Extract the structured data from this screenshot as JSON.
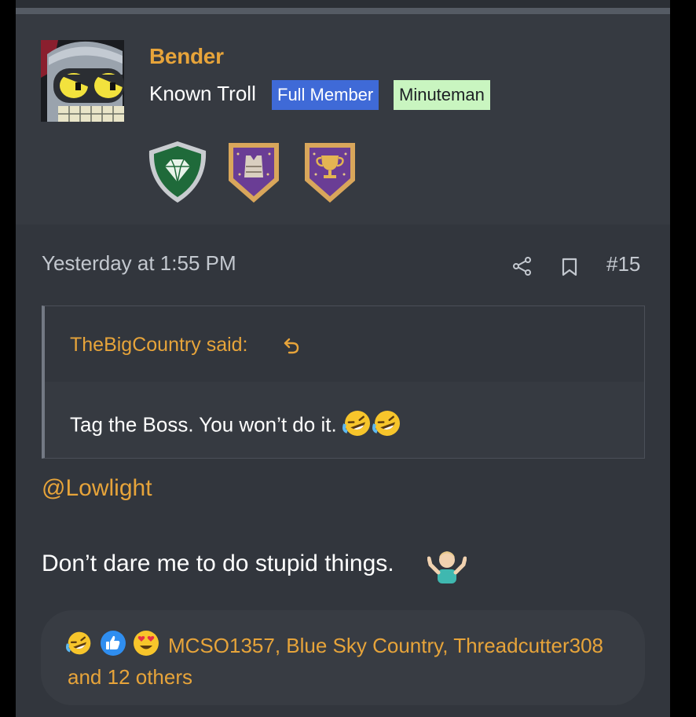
{
  "user": {
    "name": "Bender",
    "title": "Known Troll",
    "badges": [
      "Full Member",
      "Minuteman"
    ]
  },
  "trophies": [
    "diamond-shield-trophy",
    "vest-trophy",
    "cup-trophy"
  ],
  "post": {
    "timestamp": "Yesterday at 1:55 PM",
    "number": "#15",
    "quote": {
      "author": "TheBigCountry said:",
      "text": "Tag the Boss. You won’t do it."
    },
    "mention": "@Lowlight",
    "message": "Don’t dare me to do stupid things."
  },
  "reactions": {
    "icons": [
      "laugh-cry-emoji",
      "thumbs-up",
      "heart-eyes-emoji"
    ],
    "text": "MCSO1357, Blue Sky Country, Threadcutter308 and 12 others"
  },
  "colors": {
    "accent": "#e7a43a",
    "background": "#32363d",
    "full_member": "#3f6ad7",
    "minuteman": "#c9f5c0"
  }
}
